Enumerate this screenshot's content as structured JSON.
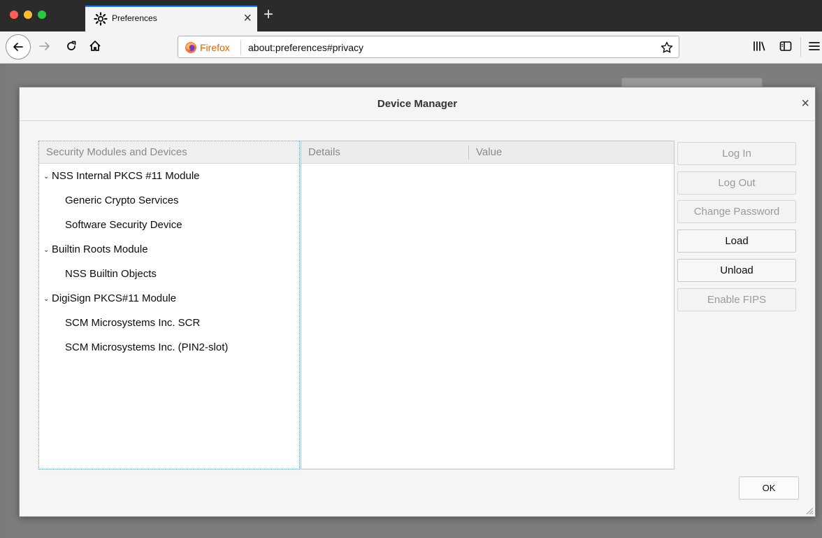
{
  "browser": {
    "tab": {
      "title": "Preferences",
      "icon": "gear-icon",
      "close_label": "×"
    },
    "newtab_label": "+",
    "url": {
      "brand": "Firefox",
      "address": "about:preferences#privacy"
    },
    "icons": [
      "back-icon",
      "forward-icon",
      "reload-icon",
      "home-icon",
      "bookmark-star-icon",
      "library-icon",
      "sidebar-icon",
      "menu-icon"
    ]
  },
  "dialog": {
    "title": "Device Manager",
    "close_label": "×",
    "tree": {
      "header": "Security Modules and Devices",
      "twisty": "⌄",
      "modules": [
        {
          "name": "NSS Internal PKCS #11 Module",
          "devices": [
            "Generic Crypto Services",
            "Software Security Device"
          ]
        },
        {
          "name": "Builtin Roots Module",
          "devices": [
            "NSS Builtin Objects"
          ]
        },
        {
          "name": "DigiSign PKCS#11 Module",
          "devices": [
            "SCM Microsystems Inc. SCR",
            "SCM Microsystems Inc. (PIN2-slot)"
          ]
        }
      ]
    },
    "details": {
      "col_details": "Details",
      "col_value": "Value"
    },
    "buttons": {
      "login": "Log In",
      "logout": "Log Out",
      "change_password": "Change Password",
      "load": "Load",
      "unload": "Unload",
      "enable_fips": "Enable FIPS",
      "ok": "OK"
    }
  },
  "colors": {
    "accent": "#0a84ff",
    "brand": "#e66000",
    "tree_focus": "#5b9bd5"
  }
}
